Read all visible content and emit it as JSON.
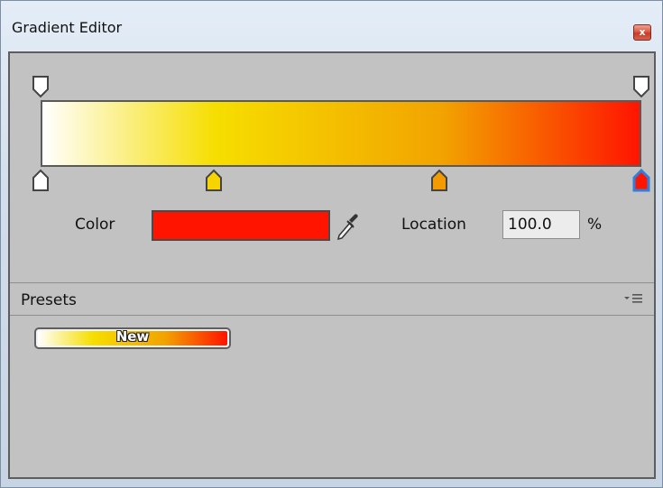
{
  "window": {
    "title": "Gradient Editor",
    "close_symbol": "x"
  },
  "gradient": {
    "alpha_keys": [
      {
        "location_percent": 0,
        "alpha": 255
      },
      {
        "location_percent": 100,
        "alpha": 255
      }
    ],
    "color_keys": [
      {
        "location_percent": 0,
        "color": "#ffffff",
        "selected": false
      },
      {
        "location_percent": 29,
        "color": "#f6d400",
        "selected": false
      },
      {
        "location_percent": 67,
        "color": "#f39a00",
        "selected": false
      },
      {
        "location_percent": 100,
        "color": "#ff1400",
        "selected": true
      }
    ]
  },
  "selected_key": {
    "color_label": "Color",
    "color": "#ff1400",
    "location_label": "Location",
    "location_value": "100.0",
    "location_unit": "%"
  },
  "presets": {
    "title": "Presets",
    "menu_icon": "dropdown-menu-icon",
    "items": [
      {
        "label": "New"
      }
    ]
  },
  "colors": {
    "selection_outline": "#2f7fe0",
    "panel_background": "#c2c2c2"
  }
}
